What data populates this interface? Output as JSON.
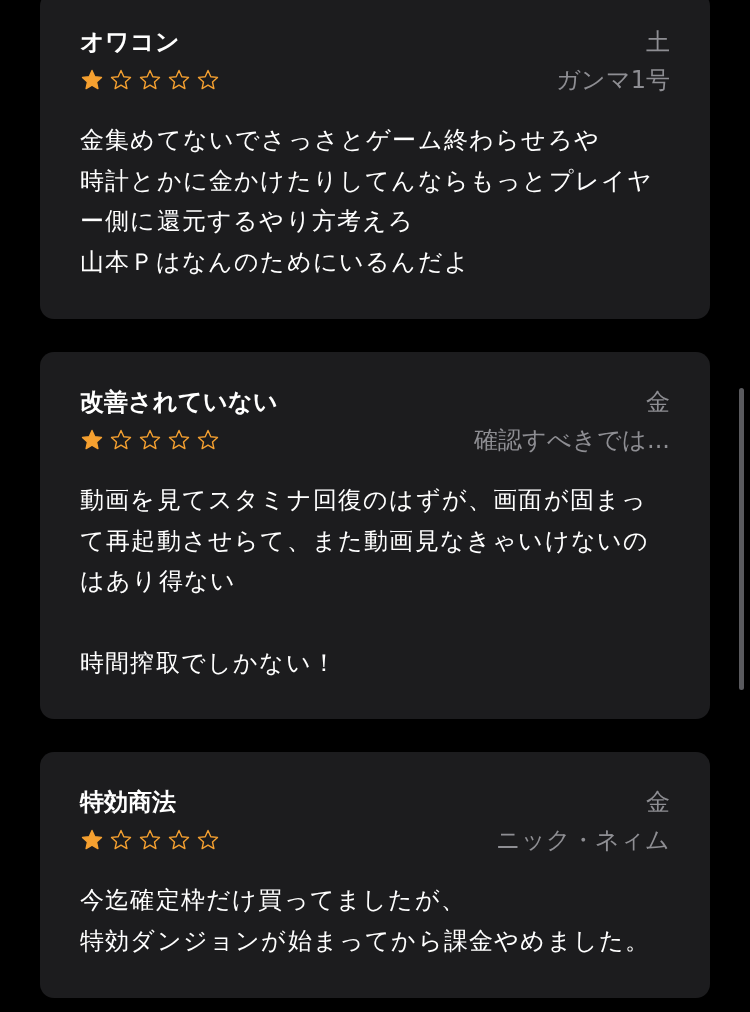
{
  "reviews": [
    {
      "title": "オワコン",
      "date": "土",
      "stars": 1,
      "author": "ガンマ1号",
      "paragraphs": [
        [
          "金集めてないでさっさとゲーム終わらせろや",
          "時計とかに金かけたりしてんならもっとプレイヤー側に還元するやり方考えろ",
          "山本Ｐはなんのためにいるんだよ"
        ]
      ]
    },
    {
      "title": "改善されていない",
      "date": "金",
      "stars": 1,
      "author": "確認すべきでは...",
      "paragraphs": [
        [
          "動画を見てスタミナ回復のはずが、画面が固まって再起動させらて、また動画見なきゃいけないのはあり得ない"
        ],
        [
          "時間搾取でしかない！"
        ]
      ]
    },
    {
      "title": "特効商法",
      "date": "金",
      "stars": 1,
      "author": "ニック・ネィム",
      "paragraphs": [
        [
          "今迄確定枠だけ買ってましたが、",
          "特効ダンジョンが始まってから課金やめました。"
        ]
      ]
    }
  ]
}
